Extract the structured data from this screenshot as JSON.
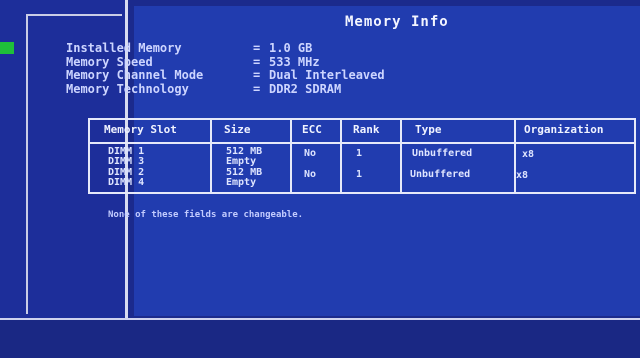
{
  "title": "Memory Info",
  "info": [
    {
      "label": "Installed Memory",
      "value": "1.0 GB"
    },
    {
      "label": "Memory Speed",
      "value": "533 MHz"
    },
    {
      "label": "Memory Channel Mode",
      "value": "Dual Interleaved"
    },
    {
      "label": "Memory Technology",
      "value": "DDR2 SDRAM"
    }
  ],
  "table": {
    "headers": [
      "Memory Slot",
      "Size",
      "ECC",
      "Rank",
      "Type",
      "Organization"
    ],
    "rows": [
      {
        "slot": "DIMM 1",
        "size": "512 MB",
        "ecc": "No",
        "rank": "1",
        "type": "Unbuffered",
        "org": "x8"
      },
      {
        "slot": "DIMM 3",
        "size": "Empty",
        "ecc": "",
        "rank": "",
        "type": "",
        "org": ""
      },
      {
        "slot": "DIMM 2",
        "size": "512 MB",
        "ecc": "No",
        "rank": "1",
        "type": "Unbuffered",
        "org": "x8"
      },
      {
        "slot": "DIMM 4",
        "size": "Empty",
        "ecc": "",
        "rank": "",
        "type": "",
        "org": ""
      }
    ]
  },
  "note": "None of these fields are changeable.",
  "colors": {
    "background": "#1b2a8c",
    "panel": "#213caf",
    "scroll_marker": "#1fbf3a"
  }
}
